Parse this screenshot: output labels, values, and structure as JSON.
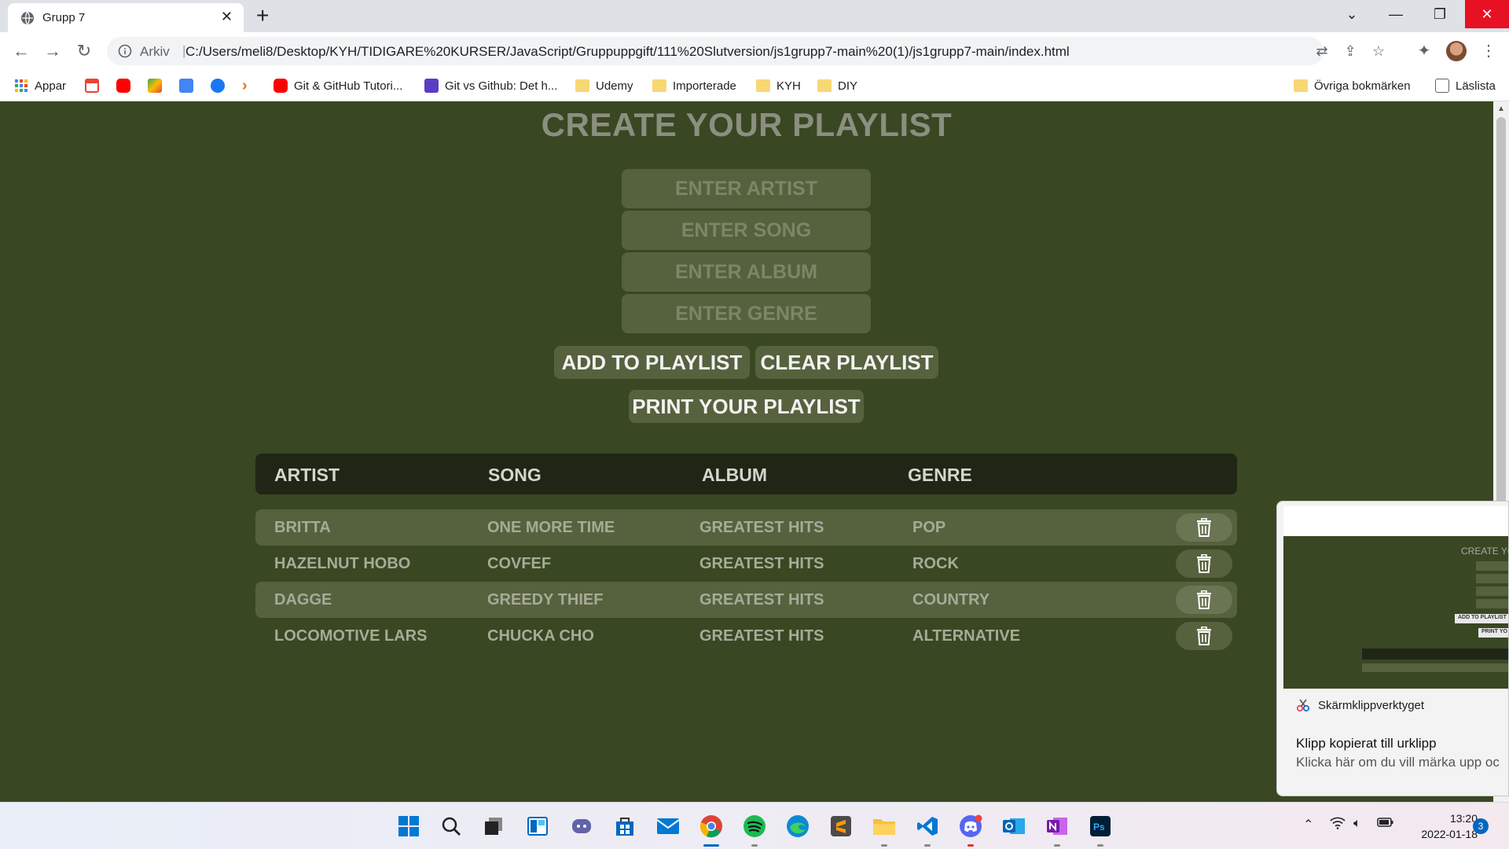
{
  "browser": {
    "tab_title": "Grupp 7",
    "address_scheme": "Arkiv",
    "address_url": "C:/Users/meli8/Desktop/KYH/TIDIGARE%20KURSER/JavaScript/Gruppuppgift/111%20Slutversion/js1grupp7-main%20(1)/js1grupp7-main/index.html"
  },
  "bookmarks": {
    "apps": "Appar",
    "git_tutorial": "Git & GitHub Tutori...",
    "git_vs_github": "Git vs Github: Det h...",
    "udemy": "Udemy",
    "importerade": "Importerade",
    "kyh": "KYH",
    "diy": "DIY",
    "other": "Övriga bokmärken",
    "reading_list": "Läslista"
  },
  "app": {
    "title": "CREATE YOUR PLAYLIST",
    "placeholders": {
      "artist": "ENTER ARTIST",
      "song": "ENTER SONG",
      "album": "ENTER ALBUM",
      "genre": "ENTER GENRE"
    },
    "buttons": {
      "add": "ADD TO PLAYLIST",
      "clear": "CLEAR PLAYLIST",
      "print": "PRINT YOUR PLAYLIST"
    },
    "columns": [
      "ARTIST",
      "SONG",
      "ALBUM",
      "GENRE"
    ],
    "rows": [
      [
        "BRITTA",
        "ONE MORE TIME",
        "GREATEST HITS",
        "POP"
      ],
      [
        "HAZELNUT HOBO",
        "COVFEF",
        "GREATEST HITS",
        "ROCK"
      ],
      [
        "DAGGE",
        "GREEDY THIEF",
        "GREATEST HITS",
        "COUNTRY"
      ],
      [
        "LOCOMOTIVE LARS",
        "CHUCKA CHO",
        "GREATEST HITS",
        "ALTERNATIVE"
      ]
    ],
    "colors": {
      "background": "#3a4723",
      "field": "#56623e",
      "header": "#1f2616"
    }
  },
  "notification": {
    "app_name": "Skärmklippverktyget",
    "heading": "Klipp kopierat till urklipp",
    "body": "Klicka här om du vill märka upp oc"
  },
  "taskbar": {
    "time": "13:20",
    "date": "2022-01-18",
    "notifications": "3"
  }
}
